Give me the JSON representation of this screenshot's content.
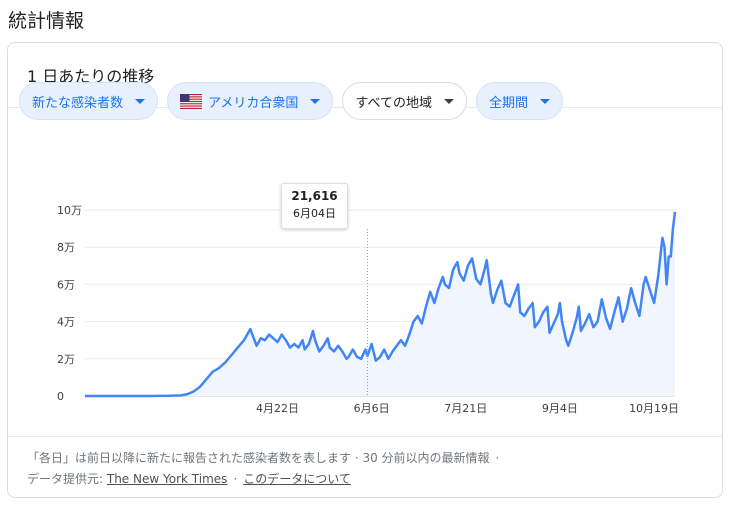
{
  "page": {
    "title": "統計情報"
  },
  "card": {
    "title": "1 日あたりの推移"
  },
  "filters": {
    "metric": "新たな感染者数",
    "country": "アメリカ合衆国",
    "region": "すべての地域",
    "period": "全期間"
  },
  "tooltip": {
    "value": "21,616",
    "date": "6月04日"
  },
  "footer": {
    "note": "「各日」は前日以降に新たに報告された感染者数を表します · 30 分前以内の最新情報",
    "dot": "·",
    "source_label": "データ提供元:",
    "source_link": "The New York Times",
    "about_link": "このデータについて"
  },
  "colors": {
    "line": "#4285f4",
    "area": "#f1f6fe",
    "chip_bg": "#e8f0fe",
    "chip_text": "#1a73e8"
  },
  "chart_data": {
    "type": "area",
    "x_start": "2020-01-21",
    "x_end": "2020-10-29",
    "y_ticks": [
      "0",
      "2万",
      "4万",
      "6万",
      "8万",
      "10万"
    ],
    "y_tick_values": [
      0,
      20000,
      40000,
      60000,
      80000,
      100000
    ],
    "ylim": [
      0,
      100000
    ],
    "x_ticks": [
      "4月22日",
      "6月6日",
      "7月21日",
      "9月4日",
      "10月19日"
    ],
    "x_tick_dates": [
      "2020-04-22",
      "2020-06-06",
      "2020-07-21",
      "2020-09-04",
      "2020-10-19"
    ],
    "grid": true,
    "highlight": {
      "date": "2020-06-04",
      "value": 21616
    },
    "points": [
      [
        "2020-01-21",
        0
      ],
      [
        "2020-02-20",
        0
      ],
      [
        "2020-03-01",
        100
      ],
      [
        "2020-03-07",
        300
      ],
      [
        "2020-03-10",
        1000
      ],
      [
        "2020-03-13",
        2500
      ],
      [
        "2020-03-16",
        5000
      ],
      [
        "2020-03-19",
        9000
      ],
      [
        "2020-03-22",
        13000
      ],
      [
        "2020-03-25",
        15000
      ],
      [
        "2020-03-28",
        18000
      ],
      [
        "2020-03-31",
        22000
      ],
      [
        "2020-04-03",
        26000
      ],
      [
        "2020-04-06",
        30000
      ],
      [
        "2020-04-08",
        34000
      ],
      [
        "2020-04-09",
        36000
      ],
      [
        "2020-04-11",
        30000
      ],
      [
        "2020-04-12",
        27000
      ],
      [
        "2020-04-14",
        31000
      ],
      [
        "2020-04-16",
        30000
      ],
      [
        "2020-04-18",
        33000
      ],
      [
        "2020-04-20",
        31000
      ],
      [
        "2020-04-22",
        29000
      ],
      [
        "2020-04-24",
        33000
      ],
      [
        "2020-04-26",
        30000
      ],
      [
        "2020-04-28",
        26000
      ],
      [
        "2020-04-30",
        28000
      ],
      [
        "2020-05-02",
        26000
      ],
      [
        "2020-05-04",
        30000
      ],
      [
        "2020-05-05",
        25000
      ],
      [
        "2020-05-07",
        28000
      ],
      [
        "2020-05-09",
        35000
      ],
      [
        "2020-05-10",
        30000
      ],
      [
        "2020-05-12",
        24000
      ],
      [
        "2020-05-14",
        27000
      ],
      [
        "2020-05-16",
        31000
      ],
      [
        "2020-05-17",
        26000
      ],
      [
        "2020-05-19",
        24000
      ],
      [
        "2020-05-21",
        27000
      ],
      [
        "2020-05-23",
        24000
      ],
      [
        "2020-05-25",
        20000
      ],
      [
        "2020-05-26",
        21000
      ],
      [
        "2020-05-28",
        25000
      ],
      [
        "2020-05-30",
        21000
      ],
      [
        "2020-06-01",
        20000
      ],
      [
        "2020-06-03",
        25000
      ],
      [
        "2020-06-04",
        21616
      ],
      [
        "2020-06-06",
        28000
      ],
      [
        "2020-06-08",
        19000
      ],
      [
        "2020-06-10",
        21000
      ],
      [
        "2020-06-12",
        25000
      ],
      [
        "2020-06-14",
        20000
      ],
      [
        "2020-06-16",
        24000
      ],
      [
        "2020-06-18",
        27000
      ],
      [
        "2020-06-20",
        30000
      ],
      [
        "2020-06-22",
        27000
      ],
      [
        "2020-06-24",
        33000
      ],
      [
        "2020-06-26",
        40000
      ],
      [
        "2020-06-28",
        43000
      ],
      [
        "2020-06-30",
        39000
      ],
      [
        "2020-07-02",
        48000
      ],
      [
        "2020-07-04",
        56000
      ],
      [
        "2020-07-06",
        50000
      ],
      [
        "2020-07-08",
        58000
      ],
      [
        "2020-07-10",
        64000
      ],
      [
        "2020-07-11",
        60000
      ],
      [
        "2020-07-13",
        58000
      ],
      [
        "2020-07-15",
        68000
      ],
      [
        "2020-07-17",
        72000
      ],
      [
        "2020-07-18",
        66000
      ],
      [
        "2020-07-20",
        62000
      ],
      [
        "2020-07-22",
        70000
      ],
      [
        "2020-07-24",
        74000
      ],
      [
        "2020-07-26",
        63000
      ],
      [
        "2020-07-28",
        60000
      ],
      [
        "2020-07-30",
        68000
      ],
      [
        "2020-07-31",
        73000
      ],
      [
        "2020-08-02",
        55000
      ],
      [
        "2020-08-03",
        50000
      ],
      [
        "2020-08-05",
        57000
      ],
      [
        "2020-08-07",
        62000
      ],
      [
        "2020-08-09",
        50000
      ],
      [
        "2020-08-11",
        48000
      ],
      [
        "2020-08-13",
        54000
      ],
      [
        "2020-08-15",
        60000
      ],
      [
        "2020-08-16",
        45000
      ],
      [
        "2020-08-18",
        43000
      ],
      [
        "2020-08-20",
        47000
      ],
      [
        "2020-08-22",
        50000
      ],
      [
        "2020-08-23",
        37000
      ],
      [
        "2020-08-25",
        40000
      ],
      [
        "2020-08-27",
        45000
      ],
      [
        "2020-08-29",
        48000
      ],
      [
        "2020-08-30",
        34000
      ],
      [
        "2020-09-01",
        39000
      ],
      [
        "2020-09-03",
        44000
      ],
      [
        "2020-09-04",
        50000
      ],
      [
        "2020-09-05",
        40000
      ],
      [
        "2020-09-07",
        30000
      ],
      [
        "2020-09-08",
        27000
      ],
      [
        "2020-09-10",
        34000
      ],
      [
        "2020-09-12",
        42000
      ],
      [
        "2020-09-13",
        48000
      ],
      [
        "2020-09-14",
        35000
      ],
      [
        "2020-09-16",
        39000
      ],
      [
        "2020-09-18",
        44000
      ],
      [
        "2020-09-20",
        37000
      ],
      [
        "2020-09-22",
        40000
      ],
      [
        "2020-09-24",
        52000
      ],
      [
        "2020-09-26",
        42000
      ],
      [
        "2020-09-28",
        36000
      ],
      [
        "2020-09-30",
        45000
      ],
      [
        "2020-10-02",
        53000
      ],
      [
        "2020-10-04",
        40000
      ],
      [
        "2020-10-06",
        47000
      ],
      [
        "2020-10-08",
        58000
      ],
      [
        "2020-10-10",
        50000
      ],
      [
        "2020-10-12",
        43000
      ],
      [
        "2020-10-14",
        60000
      ],
      [
        "2020-10-15",
        64000
      ],
      [
        "2020-10-17",
        57000
      ],
      [
        "2020-10-19",
        50000
      ],
      [
        "2020-10-21",
        65000
      ],
      [
        "2020-10-23",
        85000
      ],
      [
        "2020-10-24",
        80000
      ],
      [
        "2020-10-25",
        60000
      ],
      [
        "2020-10-26",
        75000
      ],
      [
        "2020-10-27",
        75000
      ],
      [
        "2020-10-28",
        90000
      ],
      [
        "2020-10-29",
        99000
      ]
    ]
  }
}
